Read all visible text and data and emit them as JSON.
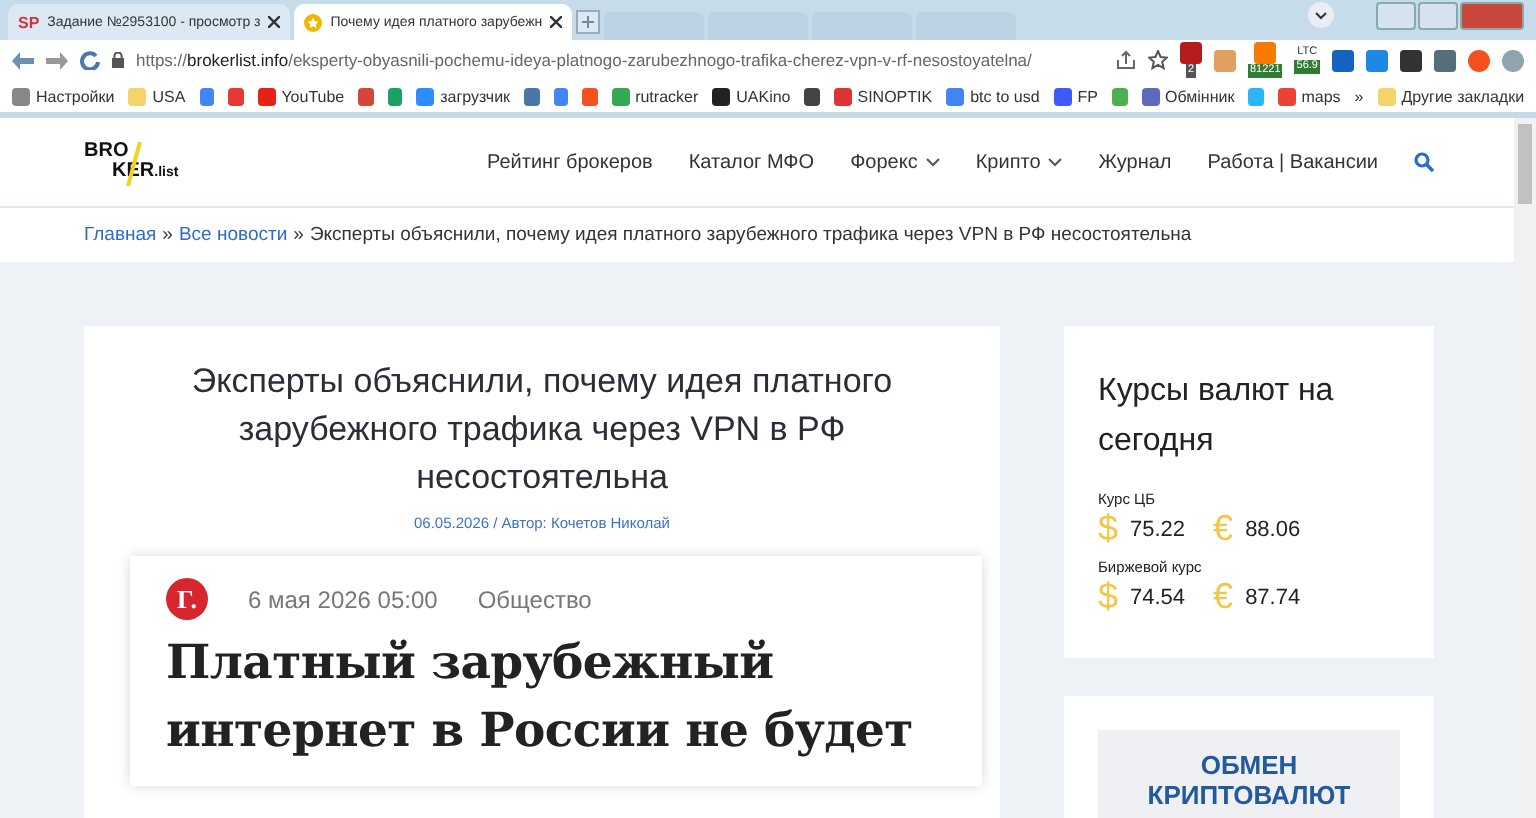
{
  "browser": {
    "tabs": [
      {
        "favicon": "SP",
        "title": "Задание №2953100 - просмотр з",
        "selected": false
      },
      {
        "title": "Почему идея платного зарубежн",
        "selected": true
      }
    ],
    "url": {
      "scheme": "https://",
      "host": "brokerlist.info",
      "path": "/eksperty-obyasnili-pochemu-ideya-platnogo-zarubezhnogo-trafika-cherez-vpn-v-rf-nesostoyatelna/"
    },
    "extension_badges": [
      "2",
      "81221",
      "LTC",
      "56.9"
    ],
    "bookmarks": [
      {
        "kind": "link",
        "label": "Настройки"
      },
      {
        "kind": "link",
        "label": "USA"
      },
      {
        "kind": "icon"
      },
      {
        "kind": "icon"
      },
      {
        "kind": "link",
        "label": "YouTube"
      },
      {
        "kind": "icon"
      },
      {
        "kind": "icon"
      },
      {
        "kind": "link",
        "label": "загрузчик"
      },
      {
        "kind": "icon"
      },
      {
        "kind": "icon"
      },
      {
        "kind": "icon"
      },
      {
        "kind": "link",
        "label": "rutracker"
      },
      {
        "kind": "link",
        "label": "UAKino"
      },
      {
        "kind": "icon"
      },
      {
        "kind": "link",
        "label": "SINOPTIK"
      },
      {
        "kind": "link",
        "label": "btc to usd"
      },
      {
        "kind": "link",
        "label": "FP"
      },
      {
        "kind": "icon"
      },
      {
        "kind": "link",
        "label": "Обмінник"
      },
      {
        "kind": "icon"
      },
      {
        "kind": "link",
        "label": "maps"
      }
    ],
    "more": "»",
    "other_bookmarks": "Другие закладки"
  },
  "site": {
    "logo": {
      "top": "BRO",
      "bottom": "KER",
      "suffix": ".list"
    },
    "nav": [
      {
        "label": "Рейтинг брокеров",
        "dropdown": false
      },
      {
        "label": "Каталог МФО",
        "dropdown": false
      },
      {
        "label": "Форекс",
        "dropdown": true
      },
      {
        "label": "Крипто",
        "dropdown": true
      },
      {
        "label": "Журнал",
        "dropdown": false
      },
      {
        "label": "Работа | Вакансии",
        "dropdown": false
      }
    ],
    "breadcrumb": {
      "links": [
        "Главная",
        "Все новости"
      ],
      "separator": "»",
      "current": "Эксперты объяснили, почему идея платного зарубежного трафика через VPN в РФ несостоятельна"
    }
  },
  "article": {
    "title": "Эксперты объяснили, почему идея платного зарубежного трафика через VPN в РФ несостоятельна",
    "meta": "06.05.2026 / Автор: Кочетов Николай",
    "embed": {
      "logo": "Г.",
      "date": "6 мая 2026 05:00",
      "rubric": "Общество",
      "headline": "Платный зарубежный интернет в России не будет"
    }
  },
  "sidebar": {
    "rates": {
      "title": "Курсы валют на сегодня",
      "groups": [
        {
          "label": "Курс ЦБ",
          "items": [
            {
              "symbol": "$",
              "value": "75.22"
            },
            {
              "symbol": "€",
              "value": "88.06"
            }
          ]
        },
        {
          "label": "Биржевой курс",
          "items": [
            {
              "symbol": "$",
              "value": "74.54"
            },
            {
              "symbol": "€",
              "value": "87.74"
            }
          ]
        }
      ]
    },
    "banner": "ОБМЕН КРИПТОВАЛЮТ"
  }
}
